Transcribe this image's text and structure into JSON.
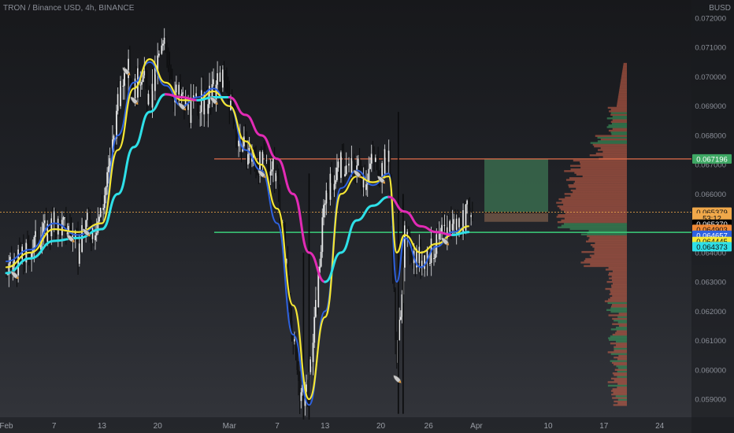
{
  "header": {
    "symbol": "TRON / Binance USD",
    "interval": "4h",
    "exchange": "BINANCE",
    "separator1": ", ",
    "separator2": ", "
  },
  "currency": "BUSD",
  "colors": {
    "up_candle": "#e8e9ea",
    "down_candle": "#111214",
    "ma_fast": "#2e62e0",
    "ma_mid": "#f5e634",
    "ma_slow_up": "#2ee0e8",
    "ma_slow_down": "#e22bb5",
    "ma_slow_flat": "#9a6bd0",
    "resistance": "#e06c4a",
    "support": "#3ccf7a",
    "profit_zone": "#3f7a55",
    "loss_zone": "#7a5b4a",
    "vp_up": "#e36a4e",
    "vp_down": "#3ea864",
    "signal_icon": "#c9c9c9"
  },
  "chart_data": {
    "type": "line",
    "title": "TRON / Binance USD, 4h, BINANCE",
    "ylim": [
      0.0585,
      0.0725
    ],
    "y_ticks": [
      "0.072000",
      "0.071000",
      "0.070000",
      "0.069000",
      "0.068000",
      "0.067000",
      "0.066000",
      "0.065000",
      "0.064000",
      "0.063000",
      "0.062000",
      "0.061000",
      "0.060000",
      "0.059000"
    ],
    "y_tick_values": [
      0.072,
      0.071,
      0.07,
      0.069,
      0.068,
      0.067,
      0.066,
      0.065,
      0.064,
      0.063,
      0.062,
      0.061,
      0.06,
      0.059
    ],
    "x_ticks": [
      "Feb",
      "7",
      "13",
      "20",
      "Mar",
      "7",
      "13",
      "20",
      "26",
      "Apr",
      "10",
      "17",
      "24"
    ],
    "x_tick_days": [
      0,
      6,
      12,
      19,
      28,
      34,
      40,
      47,
      53,
      59,
      68,
      75,
      82
    ],
    "x_range_days": [
      0,
      85
    ],
    "grid": false,
    "price_samples": {
      "days": [
        0,
        2,
        4,
        6,
        8,
        9,
        10,
        11,
        12,
        13,
        14,
        15,
        16,
        17,
        18,
        19,
        20,
        21,
        22,
        23,
        24,
        25,
        26,
        27,
        28,
        29,
        30,
        31,
        32,
        33,
        34,
        35,
        36,
        37,
        38,
        39,
        40,
        41,
        42,
        43,
        44,
        45,
        46,
        47,
        48,
        49,
        50,
        51,
        52,
        53,
        54,
        55,
        56,
        57,
        58
      ],
      "close": [
        0.0633,
        0.0638,
        0.0645,
        0.065,
        0.0648,
        0.064,
        0.065,
        0.0648,
        0.0655,
        0.067,
        0.069,
        0.0705,
        0.0695,
        0.0702,
        0.069,
        0.0705,
        0.0712,
        0.0695,
        0.0693,
        0.0688,
        0.0692,
        0.069,
        0.0695,
        0.07,
        0.0692,
        0.068,
        0.0675,
        0.0672,
        0.067,
        0.067,
        0.0665,
        0.064,
        0.061,
        0.059,
        0.0595,
        0.0625,
        0.066,
        0.0665,
        0.067,
        0.0668,
        0.067,
        0.0665,
        0.0672,
        0.0668,
        0.0675,
        0.06,
        0.0645,
        0.064,
        0.0638,
        0.064,
        0.0642,
        0.0647,
        0.065,
        0.065,
        0.0654
      ]
    },
    "series": [
      {
        "name": "",
        "color_key": "ma_fast",
        "days": [
          0,
          3,
          6,
          9,
          12,
          14,
          16,
          18,
          20,
          22,
          24,
          26,
          28,
          30,
          32,
          34,
          36,
          38,
          40,
          42,
          44,
          46,
          48,
          49,
          50,
          52,
          54,
          56,
          58
        ],
        "values": [
          0.0637,
          0.0641,
          0.065,
          0.0646,
          0.065,
          0.068,
          0.0698,
          0.0705,
          0.0697,
          0.069,
          0.0693,
          0.0696,
          0.069,
          0.0675,
          0.0668,
          0.065,
          0.0612,
          0.0588,
          0.062,
          0.0662,
          0.0668,
          0.0663,
          0.0667,
          0.063,
          0.0645,
          0.0635,
          0.0642,
          0.0647,
          0.0649
        ]
      },
      {
        "name": "",
        "color_key": "ma_mid",
        "days": [
          0,
          3,
          6,
          9,
          12,
          14,
          16,
          18,
          20,
          22,
          24,
          26,
          28,
          30,
          32,
          34,
          36,
          38,
          40,
          42,
          44,
          46,
          48,
          49,
          50,
          52,
          54,
          56,
          58
        ],
        "values": [
          0.0635,
          0.064,
          0.0648,
          0.0647,
          0.065,
          0.0675,
          0.0696,
          0.0706,
          0.0698,
          0.0692,
          0.0692,
          0.0695,
          0.069,
          0.0678,
          0.067,
          0.0655,
          0.0622,
          0.059,
          0.0618,
          0.066,
          0.0666,
          0.0664,
          0.0666,
          0.064,
          0.0646,
          0.064,
          0.0643,
          0.0646,
          0.0649
        ]
      },
      {
        "name": "",
        "color_key": "ma_slow_up",
        "days": [
          0,
          3,
          6,
          9,
          12,
          14,
          16,
          18,
          20,
          22,
          24,
          26,
          28,
          30,
          32,
          34,
          36,
          38,
          40,
          42,
          44,
          46,
          48,
          50,
          52,
          54,
          56,
          58
        ],
        "values": [
          0.0633,
          0.0638,
          0.0644,
          0.0645,
          0.0648,
          0.066,
          0.0676,
          0.0688,
          0.0694,
          0.0693,
          0.0692,
          0.0693,
          0.0693,
          0.0687,
          0.068,
          0.0672,
          0.066,
          0.064,
          0.063,
          0.064,
          0.0651,
          0.0656,
          0.0659,
          0.0654,
          0.0649,
          0.0647,
          0.0646,
          0.0647
        ]
      }
    ],
    "resistance_level": 0.067196,
    "support_level": 0.06469,
    "current_price_line": 0.065379,
    "position": {
      "entry": 0.06537,
      "target": 0.06719,
      "stop": 0.06505,
      "start_day": 60,
      "end_day": 68
    },
    "signal_days": [
      1,
      8,
      10,
      15,
      16,
      22,
      26,
      32,
      44,
      47,
      49,
      55
    ],
    "price_labels": [
      {
        "value": "0.067196",
        "price": 0.067196,
        "bg": "#3ea864",
        "fg": "#ffffff"
      },
      {
        "value": "0.065379",
        "price": 0.065379,
        "bg": "#f0a84a",
        "fg": "#111111"
      },
      {
        "value": "53:12",
        "price": 0.06518,
        "bg": "#f0a84a",
        "fg": "#111111"
      },
      {
        "value": "0.065370",
        "price": 0.06497,
        "bg": "#000000",
        "fg": "#ffffff"
      },
      {
        "value": "0.064903",
        "price": 0.06479,
        "bg": "#f08a36",
        "fg": "#111111"
      },
      {
        "value": "0.064657",
        "price": 0.06459,
        "bg": "#2e62e0",
        "fg": "#ffffff"
      },
      {
        "value": "0.064445",
        "price": 0.06438,
        "bg": "#f5e634",
        "fg": "#111111"
      },
      {
        "value": "0.064373",
        "price": 0.0642,
        "bg": "#2ee0e8",
        "fg": "#111111"
      }
    ]
  }
}
